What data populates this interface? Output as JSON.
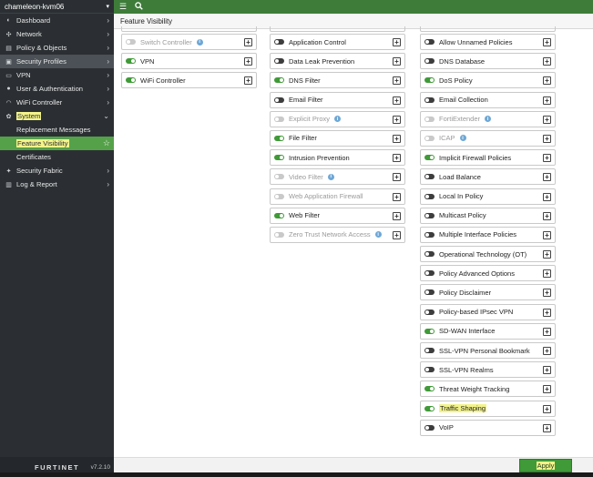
{
  "sidebar": {
    "device": "chameleon-kvm06",
    "items": [
      {
        "label": "Dashboard",
        "icon": "dashboard-icon"
      },
      {
        "label": "Network",
        "icon": "network-icon"
      },
      {
        "label": "Policy & Objects",
        "icon": "policy-icon"
      },
      {
        "label": "Security Profiles",
        "icon": "lock-icon"
      },
      {
        "label": "VPN",
        "icon": "vpn-icon"
      },
      {
        "label": "User & Authentication",
        "icon": "user-icon"
      },
      {
        "label": "WiFi Controller",
        "icon": "wifi-icon"
      },
      {
        "label": "System",
        "icon": "gear-icon"
      }
    ],
    "system_sub": [
      {
        "label": "Replacement Messages"
      },
      {
        "label": "Feature Visibility"
      },
      {
        "label": "Certificates"
      }
    ],
    "items_after": [
      {
        "label": "Security Fabric",
        "icon": "fabric-icon"
      },
      {
        "label": "Log & Report",
        "icon": "report-icon"
      }
    ],
    "logo": "FURTINET",
    "version": "v7.2.10"
  },
  "titlebar": {
    "title": "Feature Visibility"
  },
  "columns": {
    "col1": [
      {
        "label": "Switch Controller",
        "state": "disabled",
        "info": true
      },
      {
        "label": "VPN",
        "state": "on",
        "info": false
      },
      {
        "label": "WiFi Controller",
        "state": "on",
        "info": false
      }
    ],
    "col2": [
      {
        "label": "Application Control",
        "state": "off",
        "info": false
      },
      {
        "label": "Data Leak Prevention",
        "state": "off",
        "info": false
      },
      {
        "label": "DNS Filter",
        "state": "on",
        "info": false
      },
      {
        "label": "Email Filter",
        "state": "off",
        "info": false
      },
      {
        "label": "Explicit Proxy",
        "state": "disabled",
        "info": true
      },
      {
        "label": "File Filter",
        "state": "on",
        "info": false
      },
      {
        "label": "Intrusion Prevention",
        "state": "on",
        "info": false
      },
      {
        "label": "Video Filter",
        "state": "disabled",
        "info": true
      },
      {
        "label": "Web Application Firewall",
        "state": "disabled",
        "info": false
      },
      {
        "label": "Web Filter",
        "state": "on",
        "info": false
      },
      {
        "label": "Zero Trust Network Access",
        "state": "disabled",
        "info": true
      }
    ],
    "col3": [
      {
        "label": "Allow Unnamed Policies",
        "state": "off",
        "info": false
      },
      {
        "label": "DNS Database",
        "state": "off",
        "info": false
      },
      {
        "label": "DoS Policy",
        "state": "on",
        "info": false
      },
      {
        "label": "Email Collection",
        "state": "off",
        "info": false
      },
      {
        "label": "FortiExtender",
        "state": "disabled",
        "info": true
      },
      {
        "label": "ICAP",
        "state": "disabled",
        "info": true
      },
      {
        "label": "Implicit Firewall Policies",
        "state": "on",
        "info": false
      },
      {
        "label": "Load Balance",
        "state": "off",
        "info": false
      },
      {
        "label": "Local In Policy",
        "state": "off",
        "info": false
      },
      {
        "label": "Multicast Policy",
        "state": "off",
        "info": false
      },
      {
        "label": "Multiple Interface Policies",
        "state": "off",
        "info": false
      },
      {
        "label": "Operational Technology (OT)",
        "state": "off",
        "info": false
      },
      {
        "label": "Policy Advanced Options",
        "state": "off",
        "info": false
      },
      {
        "label": "Policy Disclaimer",
        "state": "off",
        "info": false
      },
      {
        "label": "Policy-based IPsec VPN",
        "state": "off",
        "info": false
      },
      {
        "label": "SD-WAN Interface",
        "state": "on",
        "info": false
      },
      {
        "label": "SSL-VPN Personal Bookmark",
        "state": "off",
        "info": false
      },
      {
        "label": "SSL-VPN Realms",
        "state": "off",
        "info": false
      },
      {
        "label": "Threat Weight Tracking",
        "state": "on",
        "info": false
      },
      {
        "label": "Traffic Shaping",
        "state": "on",
        "info": false,
        "highlight": true
      },
      {
        "label": "VoIP",
        "state": "off",
        "info": false
      }
    ]
  },
  "footer": {
    "apply_label": "Apply"
  },
  "colors": {
    "accent": "#3f9a37",
    "sidebar_bg": "#2b2f33",
    "highlight": "#f3f38a",
    "topbar": "#3e7c3a"
  }
}
